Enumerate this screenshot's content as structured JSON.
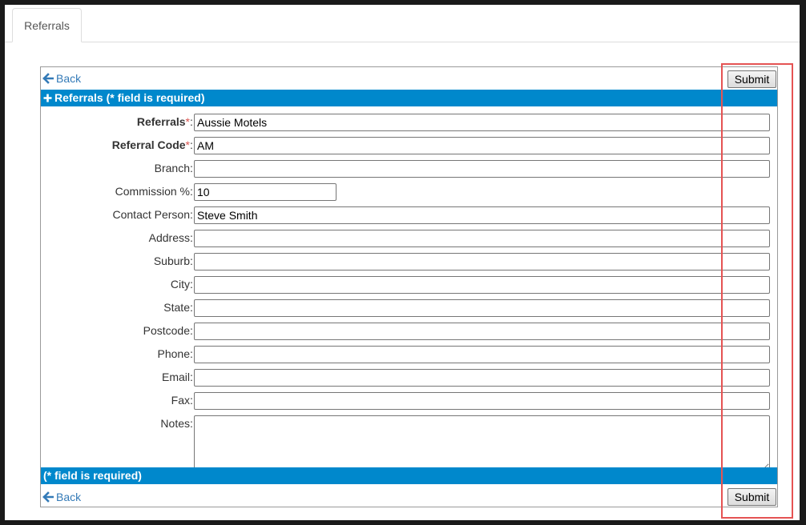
{
  "tab": {
    "label": "Referrals"
  },
  "nav": {
    "back_label": "Back"
  },
  "actions": {
    "submit_label": "Submit"
  },
  "header_bar": {
    "title": "Referrals (* field is required)"
  },
  "footer_bar": {
    "title": "(* field is required)"
  },
  "form": {
    "required_mark": "*",
    "fields": [
      {
        "label": "Referrals",
        "required": true,
        "value": "Aussie Motels"
      },
      {
        "label": "Referral Code",
        "required": true,
        "value": "AM"
      },
      {
        "label": "Branch",
        "value": ""
      },
      {
        "label": "Commission %",
        "value": "10"
      },
      {
        "label": "Contact Person",
        "value": "Steve Smith"
      },
      {
        "label": "Address",
        "value": ""
      },
      {
        "label": "Suburb",
        "value": ""
      },
      {
        "label": "City",
        "value": ""
      },
      {
        "label": "State",
        "value": ""
      },
      {
        "label": "Postcode",
        "value": ""
      },
      {
        "label": "Phone",
        "value": ""
      },
      {
        "label": "Email",
        "value": ""
      },
      {
        "label": "Fax",
        "value": ""
      },
      {
        "label": "Notes",
        "value": ""
      }
    ]
  },
  "colors": {
    "bar": "#0088cc",
    "link": "#337ab7",
    "required": "#d9534f",
    "highlight": "#e55353"
  },
  "icons": {
    "back": "arrow-left-icon",
    "section": "plus-icon"
  }
}
